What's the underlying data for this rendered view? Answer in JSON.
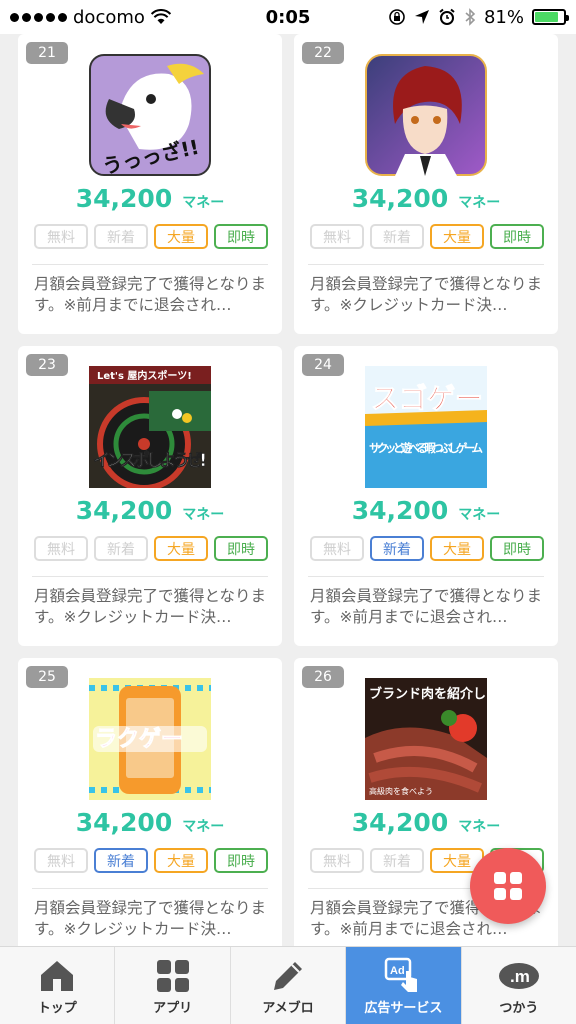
{
  "statusbar": {
    "carrier": "docomo",
    "time": "0:05",
    "battery": "81%",
    "battery_level": 0.81
  },
  "cards": [
    {
      "num": "21",
      "price": "34,200",
      "unit": "マネー",
      "tags": [
        "無料",
        "新着",
        "大量",
        "即時"
      ],
      "active_tags": [
        false,
        false,
        true,
        true
      ],
      "desc": "月額会員登録完了で獲得となります。※前月までに退会され…",
      "thumb": "cockatoo-thumb",
      "thumb_text": "うっっざ!!"
    },
    {
      "num": "22",
      "price": "34,200",
      "unit": "マネー",
      "tags": [
        "無料",
        "新着",
        "大量",
        "即時"
      ],
      "active_tags": [
        false,
        false,
        true,
        true
      ],
      "desc": "月額会員登録完了で獲得となります。※クレジットカード決…",
      "thumb": "anime-boy-thumb",
      "thumb_text": ""
    },
    {
      "num": "23",
      "price": "34,200",
      "unit": "マネー",
      "tags": [
        "無料",
        "新着",
        "大量",
        "即時"
      ],
      "active_tags": [
        false,
        false,
        true,
        true
      ],
      "desc": "月額会員登録完了で獲得となります。※クレジットカード決…",
      "thumb": "darts-thumb",
      "thumb_text": "インスポしようぜ!",
      "thumb_sub": "Let's 屋内スポーツ!"
    },
    {
      "num": "24",
      "price": "34,200",
      "unit": "マネー",
      "tags": [
        "無料",
        "新着",
        "大量",
        "即時"
      ],
      "active_tags": [
        false,
        true,
        true,
        true
      ],
      "desc": "月額会員登録完了で獲得となります。※前月までに退会され…",
      "thumb": "sugoge-thumb",
      "thumb_text": "スゴゲー",
      "thumb_sub": "サクッと遊べる暇つぶしゲーム"
    },
    {
      "num": "25",
      "price": "34,200",
      "unit": "マネー",
      "tags": [
        "無料",
        "新着",
        "大量",
        "即時"
      ],
      "active_tags": [
        false,
        true,
        true,
        true
      ],
      "desc": "月額会員登録完了で獲得となります。※クレジットカード決…",
      "thumb": "rakuge-thumb",
      "thumb_text": "ラクゲー"
    },
    {
      "num": "26",
      "price": "34,200",
      "unit": "マネー",
      "tags": [
        "無料",
        "新着",
        "大量",
        "即時"
      ],
      "active_tags": [
        false,
        false,
        true,
        true
      ],
      "desc": "月額会員登録完了で獲得となります。※前月までに退会され…",
      "thumb": "steak-thumb",
      "thumb_text": "ブランド肉を紹介します",
      "thumb_sub": "高級肉を食べよう"
    }
  ],
  "tabs": [
    {
      "label": "トップ",
      "icon": "home-icon",
      "active": false
    },
    {
      "label": "アプリ",
      "icon": "grid-icon",
      "active": false
    },
    {
      "label": "アメブロ",
      "icon": "pencil-icon",
      "active": false
    },
    {
      "label": "広告サービス",
      "icon": "ad-tap-icon",
      "active": true
    },
    {
      "label": "つかう",
      "icon": "money-icon",
      "active": false
    }
  ],
  "colors": {
    "accent_green": "#2ec4a3",
    "tag_orange": "#f5a623",
    "tag_green": "#4caf50",
    "tag_blue": "#4a7fd4",
    "fab_red": "#f05a5a",
    "tab_active": "#4b90e2"
  }
}
